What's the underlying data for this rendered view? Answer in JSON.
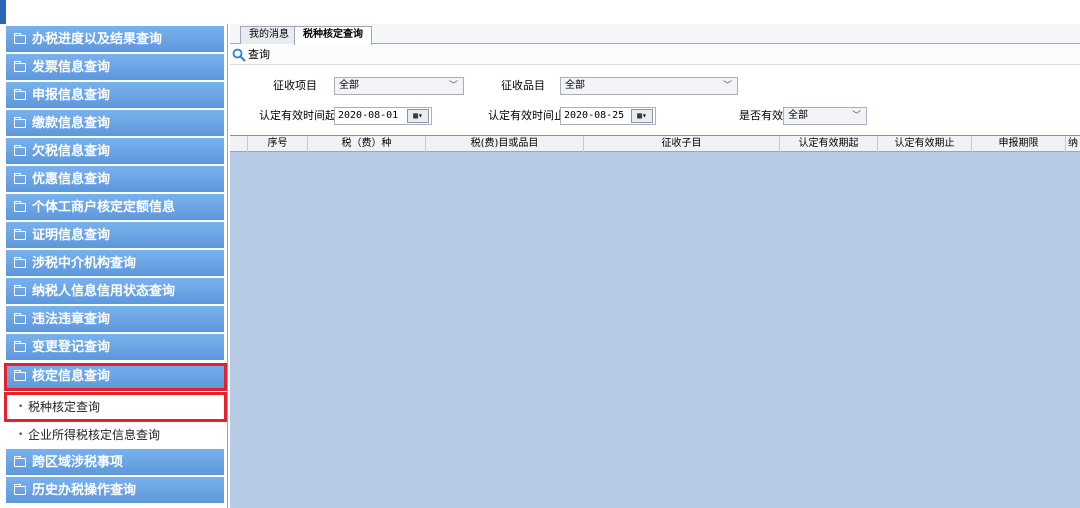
{
  "sidebar": {
    "menu": [
      "办税进度以及结果查询",
      "发票信息查询",
      "申报信息查询",
      "缴款信息查询",
      "欠税信息查询",
      "优惠信息查询",
      "个体工商户核定定额信息",
      "证明信息查询",
      "涉税中介机构查询",
      "纳税人信息信用状态查询",
      "违法违章查询",
      "变更登记查询",
      "核定信息查询"
    ],
    "submenu": [
      "税种核定查询",
      "企业所得税核定信息查询"
    ],
    "menu_after": [
      "跨区域涉税事项",
      "历史办税操作查询"
    ]
  },
  "tabs": [
    "我的消息",
    "税种核定查询"
  ],
  "toolbar": {
    "query_label": "查询"
  },
  "form": {
    "collect_item_label": "征收项目",
    "collect_item_value": "全部",
    "collect_category_label": "征收品目",
    "collect_category_value": "全部",
    "valid_start_label": "认定有效时间起",
    "valid_start_value": "2020-08-01",
    "valid_end_label": "认定有效时间止",
    "valid_end_value": "2020-08-25",
    "is_valid_label": "是否有效",
    "is_valid_value": "全部"
  },
  "table": {
    "columns": [
      "序号",
      "税（费）种",
      "税(费)目或品目",
      "征收子目",
      "认定有效期起",
      "认定有效期止",
      "申报期限",
      "纳"
    ]
  },
  "colors": {
    "menu": "#5d98dc",
    "highlight": "#e1232d",
    "grid_bg": "#b7cbe4"
  }
}
